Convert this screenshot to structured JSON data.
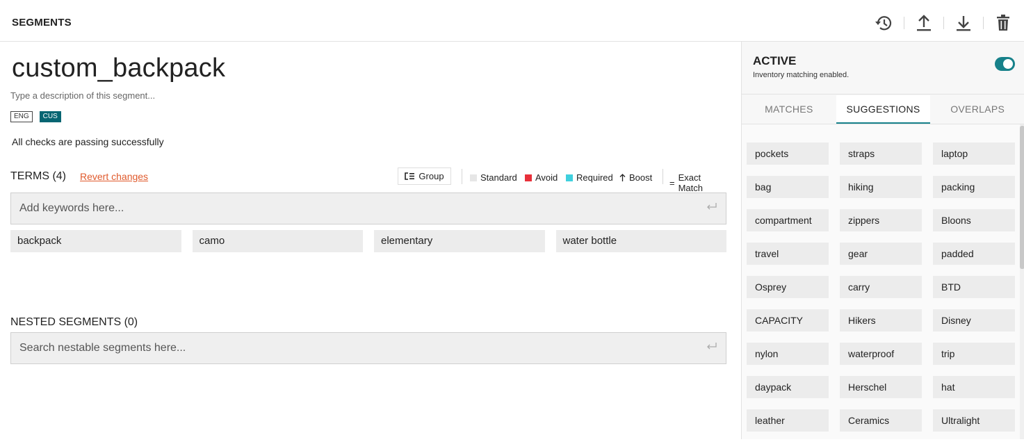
{
  "header": {
    "title": "SEGMENTS",
    "tools": [
      "history-icon",
      "upload-icon",
      "download-icon",
      "trash-icon"
    ]
  },
  "segment": {
    "name": "custom_backpack",
    "description_placeholder": "Type a description of this segment...",
    "languages": [
      "ENG",
      "CUS"
    ],
    "active_language": "CUS",
    "check_status": "All checks are passing successfully"
  },
  "terms": {
    "title": "TERMS (4)",
    "revert_label": "Revert changes",
    "group_label": "Group",
    "legend": {
      "standard": "Standard",
      "avoid": "Avoid",
      "required": "Required",
      "boost": "Boost",
      "exact": "Exact Match"
    },
    "colors": {
      "standard": "#e6e6e6",
      "avoid": "#e8303a",
      "required": "#3fd0de"
    },
    "input_placeholder": "Add keywords here...",
    "items": [
      "backpack",
      "camo",
      "elementary",
      "water bottle"
    ]
  },
  "nested": {
    "title": "NESTED SEGMENTS (0)",
    "input_placeholder": "Search nestable segments here..."
  },
  "side": {
    "status_title": "ACTIVE",
    "status_sub": "Inventory matching enabled.",
    "active": true,
    "accent": "#17818a",
    "tabs": [
      "MATCHES",
      "SUGGESTIONS",
      "OVERLAPS"
    ],
    "active_tab": "SUGGESTIONS",
    "suggestions": [
      "pockets",
      "straps",
      "laptop",
      "bag",
      "hiking",
      "packing",
      "compartment",
      "zippers",
      "Bloons",
      "travel",
      "gear",
      "padded",
      "Osprey",
      "carry",
      "BTD",
      "CAPACITY",
      "Hikers",
      "Disney",
      "nylon",
      "waterproof",
      "trip",
      "daypack",
      "Herschel",
      "hat",
      "leather",
      "Ceramics",
      "Ultralight"
    ]
  }
}
